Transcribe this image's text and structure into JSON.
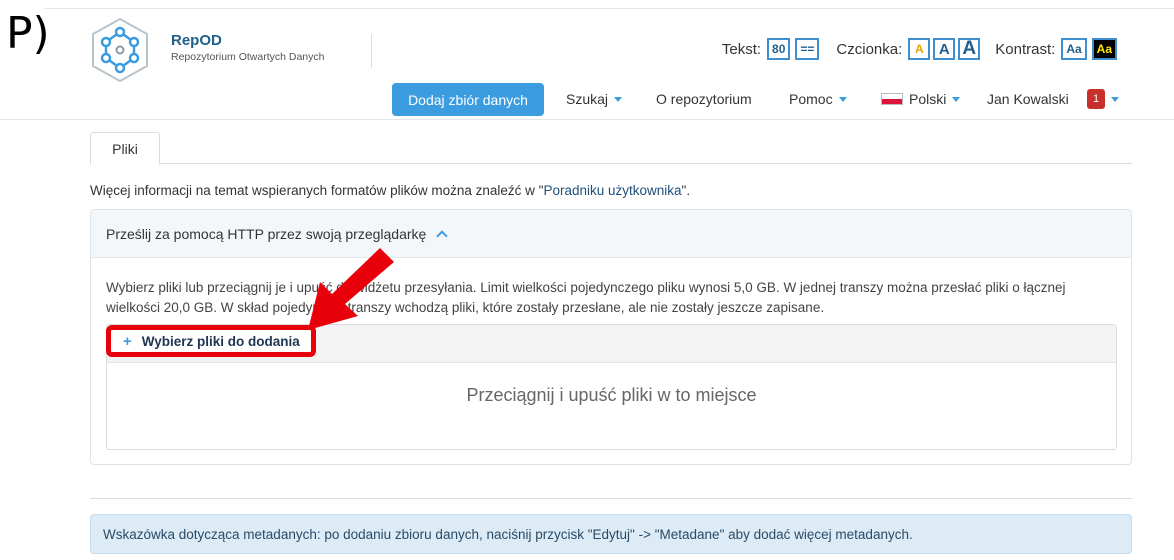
{
  "step_label": "P)",
  "brand": {
    "name": "RepOD",
    "subtitle": "Repozytorium Otwartych Danych"
  },
  "accessibility": {
    "text_label": "Tekst:",
    "text_size_value": "80",
    "text_spacing_symbol": "==",
    "font_label": "Czcionka:",
    "font_small": "A",
    "font_medium": "A",
    "font_large": "A",
    "contrast_label": "Kontrast:",
    "contrast_normal": "Aa",
    "contrast_high": "Aa",
    "colors": {
      "accent": "#3e8ed0",
      "high_contrast_fg": "#ffeb00",
      "high_contrast_bg": "#000000"
    }
  },
  "nav": {
    "add_dataset": "Dodaj zbiór danych",
    "search": "Szukaj",
    "about": "O repozytorium",
    "help": "Pomoc",
    "language": "Polski",
    "user": "Jan Kowalski",
    "notifications": "1"
  },
  "tabs": [
    {
      "label": "Pliki"
    }
  ],
  "info": {
    "prefix": "Więcej informacji na temat wspieranych formatów plików można znaleźć w \"",
    "link": "Poradniku użytkownika",
    "suffix": "\"."
  },
  "upload_panel": {
    "title": "Prześlij za pomocą HTTP przez swoją przeglądarkę",
    "description": "Wybierz pliki lub przeciągnij je i upuść do widżetu przesyłania. Limit wielkości pojedynczego pliku wynosi 5,0 GB. W jednej transzy można przesłać pliki o łącznej wielkości 20,0 GB. W skład pojedynczej transzy wchodzą pliki, które zostały przesłane, ale nie zostały jeszcze zapisane.",
    "choose_files": "Wybierz pliki do dodania",
    "choose_plus": "+",
    "dropzone_text": "Przeciągnij i upuść pliki w to miejsce"
  },
  "metadata_hint": "Wskazówka dotycząca metadanych: po dodaniu zbioru danych, naciśnij przycisk \"Edytuj\" -> \"Metadane\" aby dodać więcej metadanych.",
  "colors": {
    "primary": "#3b9ce0",
    "highlight": "#e8000b",
    "hint_bg": "#dcebf6"
  }
}
